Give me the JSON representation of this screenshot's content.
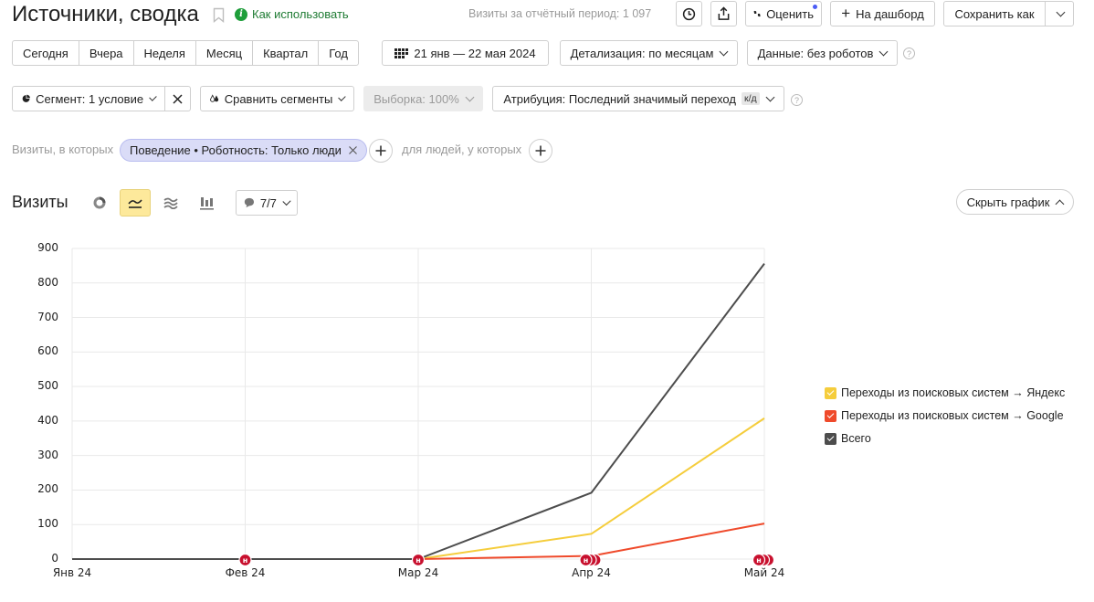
{
  "header": {
    "title": "Источники, сводка",
    "how_to_use": "Как использовать",
    "visits_period_label": "Визиты за отчётный период:",
    "visits_period_value": "1 097",
    "rate_label": "Оценить",
    "dashboard_label": "На дашборд",
    "save_as_label": "Сохранить как"
  },
  "period": {
    "buttons": [
      "Сегодня",
      "Вчера",
      "Неделя",
      "Месяц",
      "Квартал",
      "Год"
    ],
    "date_range": "21 янв — 22 мая 2024",
    "detail": "Детализация: по месяцам",
    "data_filter": "Данные: без роботов"
  },
  "segment": {
    "segment_label": "Сегмент: 1 условие",
    "compare_label": "Сравнить сегменты",
    "sample_label": "Выборка: 100%",
    "attribution_label": "Атрибуция: Последний значимый переход",
    "attribution_badge": "к/д"
  },
  "filters": {
    "visits_which": "Визиты, в которых",
    "chip_label": "Поведение • Роботность: Только люди",
    "for_people": "для людей, у которых"
  },
  "chart_section": {
    "title": "Визиты",
    "series_counter": "7/7",
    "hide_chart": "Скрыть график"
  },
  "colors": {
    "yandex": "#f5cd3c",
    "google": "#ef4a2b",
    "total": "#4d4d4d",
    "accent_green": "#1e9e3a",
    "marker": "#c8102e"
  },
  "chart_data": {
    "type": "line",
    "x": [
      "Янв 24",
      "Фев 24",
      "Мар 24",
      "Апр 24",
      "Май 24"
    ],
    "ylim": [
      0,
      900
    ],
    "yticks": [
      0,
      100,
      200,
      300,
      400,
      500,
      600,
      700,
      800,
      900
    ],
    "series": [
      {
        "name": "Переходы из поисковых систем → Яндекс",
        "color": "#f5cd3c",
        "values": [
          0,
          0,
          0,
          73,
          408
        ]
      },
      {
        "name": "Переходы из поисковых систем → Google",
        "color": "#ef4a2b",
        "values": [
          0,
          0,
          0,
          9,
          103
        ]
      },
      {
        "name": "Всего",
        "color": "#4d4d4d",
        "values": [
          0,
          0,
          0,
          192,
          856
        ]
      }
    ],
    "annotation_marker": "н",
    "annotations": [
      {
        "x": "Фев 24",
        "count": 1
      },
      {
        "x": "Мар 24",
        "count": 1
      },
      {
        "x": "Апр 24",
        "count": 3
      },
      {
        "x": "Май 24",
        "count": 3
      }
    ],
    "grid": true,
    "legend": "right"
  }
}
